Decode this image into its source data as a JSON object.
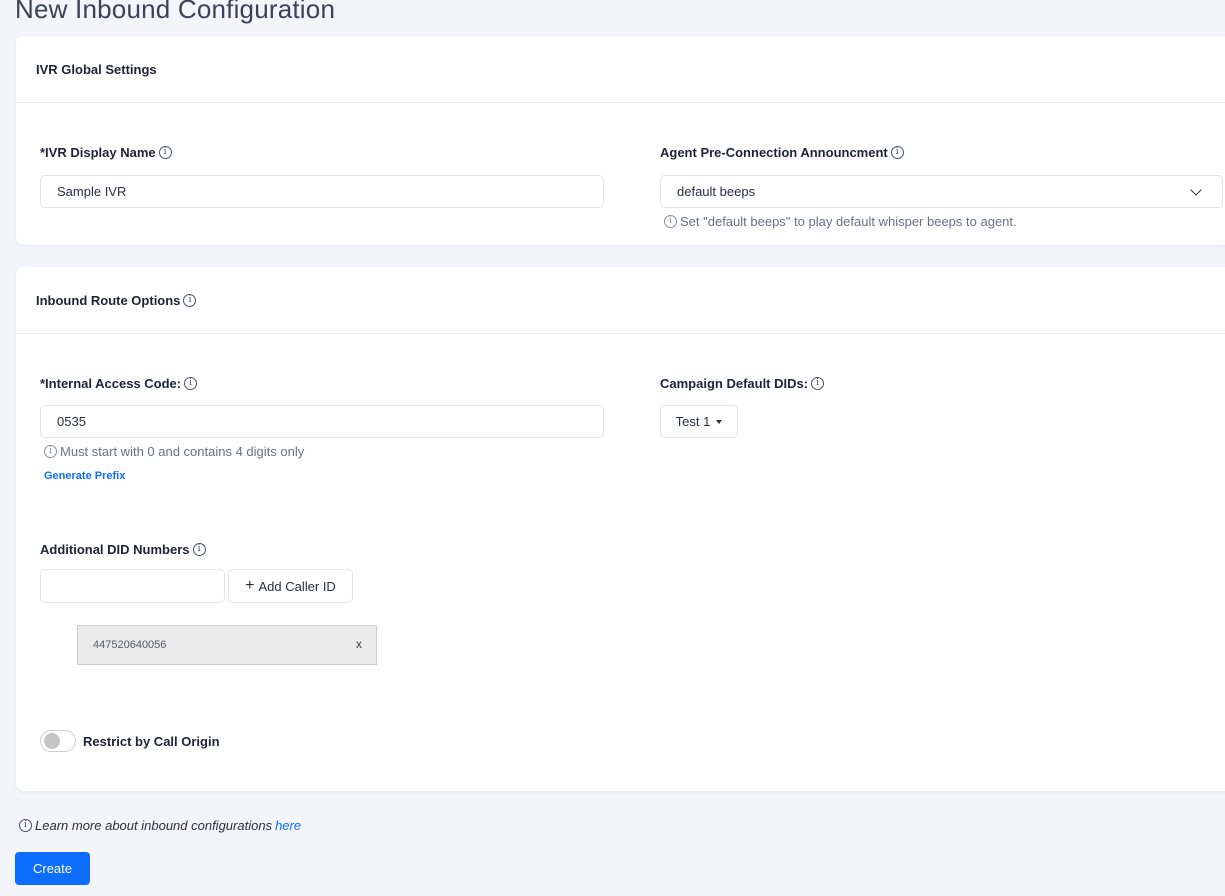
{
  "page": {
    "title": "New Inbound Configuration"
  },
  "global_settings": {
    "header": "IVR Global Settings",
    "ivr_display_name": {
      "label": "*IVR Display Name",
      "value": "Sample IVR"
    },
    "announcement": {
      "label": "Agent Pre-Connection Announcment",
      "selected": "default beeps",
      "helper": "Set \"default beeps\" to play default whisper beeps to agent."
    }
  },
  "route_options": {
    "header": "Inbound Route Options",
    "access_code": {
      "label": "*Internal Access Code:",
      "value": "0535",
      "helper": "Must start with 0 and contains 4 digits only",
      "generate_label": "Generate Prefix"
    },
    "campaign_dids": {
      "label": "Campaign Default DIDs:",
      "selected": "Test 1"
    },
    "additional_dids": {
      "label": "Additional DID Numbers",
      "input_value": "",
      "add_label": "Add Caller ID",
      "numbers": [
        "447520640056"
      ],
      "remove_symbol": "x"
    },
    "restrict": {
      "label": "Restrict by Call Origin",
      "enabled": false
    }
  },
  "footer": {
    "note": "Learn more about inbound configurations",
    "link": "here",
    "create_label": "Create"
  },
  "icons": {
    "info": "i",
    "plus": "+"
  },
  "colors": {
    "accent": "#0d6efd",
    "background": "#f4f5fa"
  }
}
